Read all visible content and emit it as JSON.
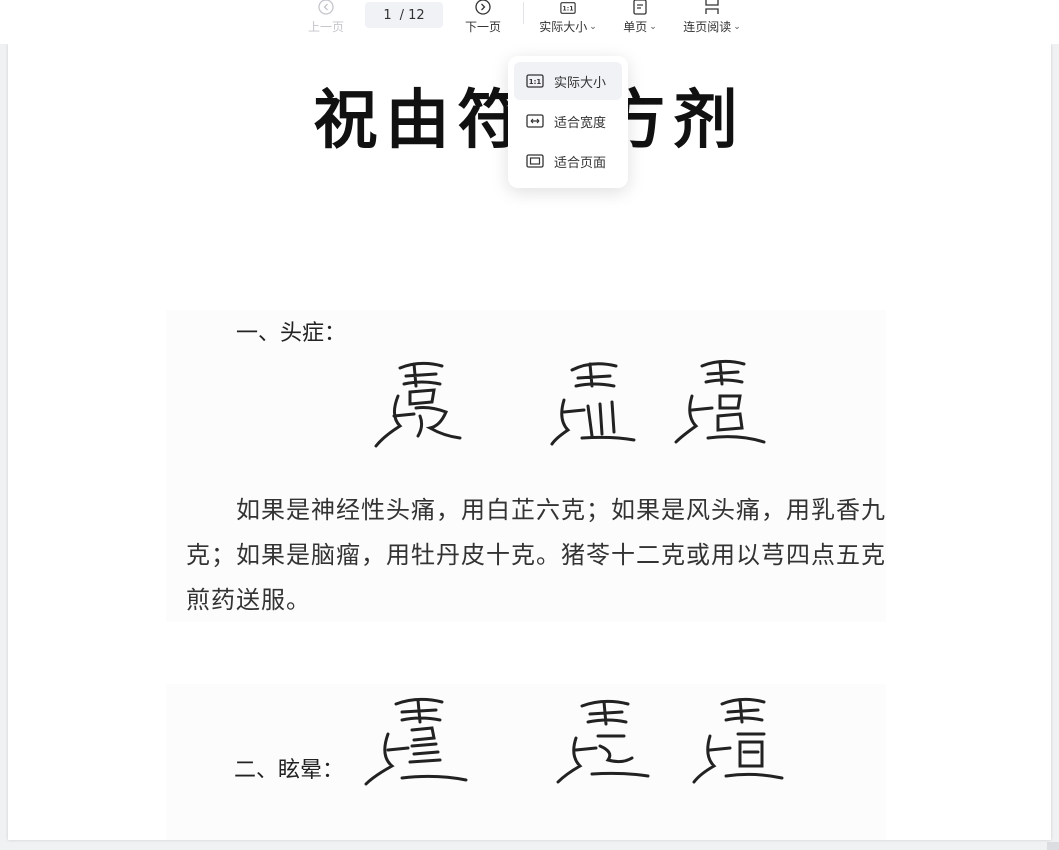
{
  "toolbar": {
    "prev_label": "上一页",
    "next_label": "下一页",
    "current_page": "1",
    "total_pages": "/ 12",
    "zoom_label": "实际大小",
    "view_label": "单页",
    "read_label": "连页阅读",
    "icons": {
      "prev": "chevron-left-circle-icon",
      "next": "chevron-right-circle-icon",
      "zoom": "actual-size-icon",
      "view": "single-page-icon",
      "read": "continuous-read-icon"
    }
  },
  "zoom_menu": {
    "items": [
      {
        "label": "实际大小",
        "icon": "actual-size-icon",
        "active": true
      },
      {
        "label": "适合宽度",
        "icon": "fit-width-icon",
        "active": false
      },
      {
        "label": "适合页面",
        "icon": "fit-page-icon",
        "active": false
      }
    ]
  },
  "document": {
    "title": "祝由符咒方剂",
    "section1_heading": "一、头症：",
    "section1_body": "如果是神经性头痛，用白芷六克；如果是风头痛，用乳香九克；如果是脑瘤，用牡丹皮十克。猪苓十二克或用以芎四点五克煎药送服。",
    "section2_heading": "二、眩晕："
  },
  "colors": {
    "toolbar_bg": "#ffffff",
    "page_bg": "#ffffff",
    "app_bg": "#f0f1f3",
    "menu_active_bg": "#f0f2f6",
    "text": "#333333"
  }
}
